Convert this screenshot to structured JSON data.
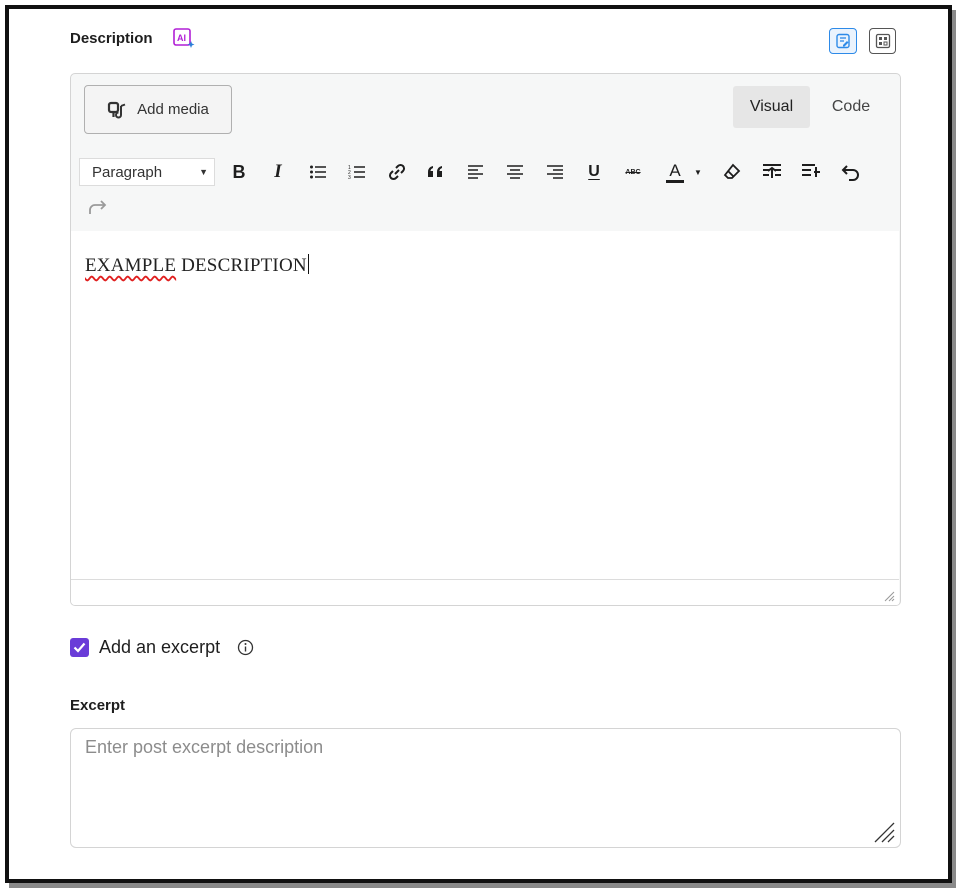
{
  "description": {
    "label": "Description",
    "ai_badge": "AI",
    "ai_badge_color": "#b11fd6"
  },
  "editor": {
    "add_media_label": "Add media",
    "tabs": [
      {
        "label": "Visual",
        "active": true
      },
      {
        "label": "Code",
        "active": false
      }
    ],
    "format_select": "Paragraph",
    "toolbar_icons": [
      "bold-icon",
      "italic-icon",
      "bullet-list-icon",
      "numbered-list-icon",
      "link-icon",
      "blockquote-icon",
      "align-left-icon",
      "align-center-icon",
      "align-right-icon",
      "underline-icon",
      "strikethrough-icon",
      "text-color-icon",
      "clear-formatting-icon",
      "indent-icon",
      "outdent-icon",
      "undo-icon",
      "redo-icon"
    ],
    "toolbar_text": {
      "bold": "B",
      "italic": "I",
      "underline": "U",
      "strikethrough": "ABC",
      "text_color": "A"
    },
    "content": {
      "misspelled_word": "EXAMPLE",
      "rest": " DESCRIPTION"
    }
  },
  "excerpt": {
    "checkbox_label": "Add an excerpt",
    "checked": true,
    "accent_color": "#6a3cd8",
    "label": "Excerpt",
    "placeholder": "Enter post excerpt description",
    "value": ""
  }
}
